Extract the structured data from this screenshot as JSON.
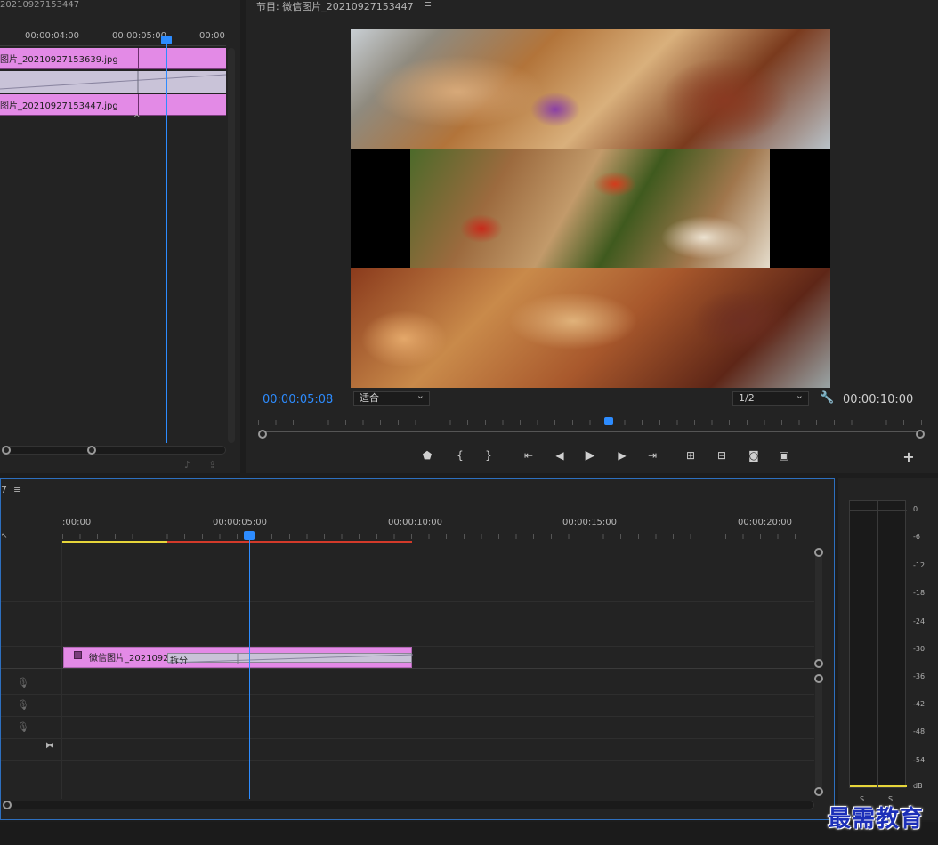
{
  "source_panel": {
    "title_fragment": "20210927153447",
    "ruler_labels": [
      "00:00:04:00",
      "00:00:05:00",
      "00:00"
    ],
    "clip_v2": "图片_20210927153639.jpg",
    "clip_v1": "图片_20210927153447.jpg"
  },
  "program_monitor": {
    "title": "节目: 微信图片_20210927153447",
    "menu_icon": "≡",
    "timecode_current": "00:00:05:08",
    "fit_label": "适合",
    "resolution_label": "1/2",
    "timecode_duration": "00:00:10:00",
    "add_button": "+"
  },
  "timeline": {
    "title_fragment": "7",
    "menu_icon": "≡",
    "ruler_labels": [
      ":00:00",
      "00:00:05:00",
      "00:00:10:00",
      "00:00:15:00",
      "00:00:20:00"
    ],
    "clip_name": "微信图片_2021092",
    "effect_label": "拆分"
  },
  "audio_meter": {
    "scale": [
      "0",
      "-6",
      "-12",
      "-18",
      "-24",
      "-30",
      "-36",
      "-42",
      "-48",
      "-54",
      "dB"
    ],
    "channel_labels": [
      "S",
      "S"
    ]
  },
  "watermark": "最需教育",
  "colors": {
    "clip_pink": "#e38ae6",
    "playhead_blue": "#2d8cff",
    "timecode_blue": "#2d8cff",
    "work_area_yellow": "#e6d53a",
    "render_red": "#d33a2a"
  }
}
